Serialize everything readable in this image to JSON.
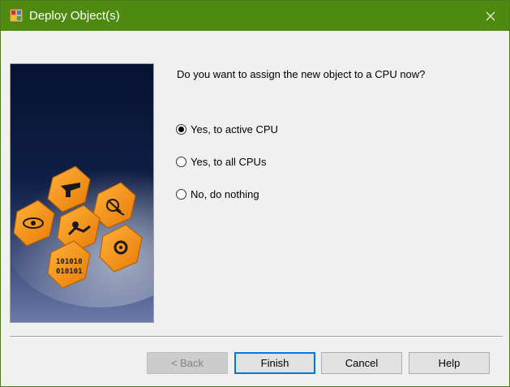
{
  "window": {
    "title": "Deploy Object(s)"
  },
  "question": "Do you want to assign the new object to a CPU now?",
  "options": [
    {
      "label": "Yes, to active CPU",
      "selected": true
    },
    {
      "label": "Yes, to all CPUs",
      "selected": false
    },
    {
      "label": "No, do nothing",
      "selected": false
    }
  ],
  "buttons": {
    "back": "< Back",
    "finish": "Finish",
    "cancel": "Cancel",
    "help": "Help"
  },
  "colors": {
    "titlebar": "#4f8a10",
    "hex_orange": "#f08a10",
    "default_button_border": "#0078d7"
  },
  "image": {
    "binary_digits_top": "101010",
    "binary_digits_bottom": "010101"
  }
}
